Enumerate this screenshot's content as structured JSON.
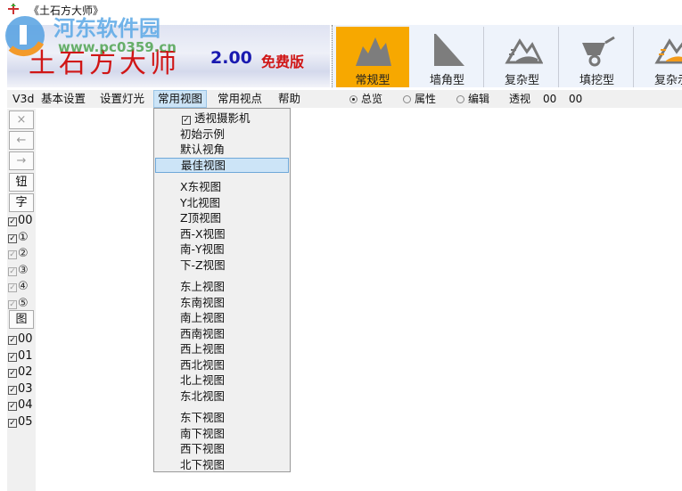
{
  "window": {
    "title": "《土石方大师》"
  },
  "banner": {
    "name": "土石方大师",
    "version": "2.00",
    "edition": "免费版"
  },
  "watermark": {
    "text": "河东软件园",
    "url": "www.pc0359.cn"
  },
  "toolbar": {
    "buttons": [
      {
        "label": "常规型",
        "icon": "mountain-icon",
        "active": true
      },
      {
        "label": "墙角型",
        "icon": "slope-icon",
        "active": false
      },
      {
        "label": "复杂型",
        "icon": "complex-terrain-icon",
        "active": false
      },
      {
        "label": "填挖型",
        "icon": "wheelbarrow-icon",
        "active": false
      },
      {
        "label": "复杂示",
        "icon": "complex-example-icon",
        "active": false
      }
    ]
  },
  "menubar": {
    "items": [
      "V3d",
      "基本设置",
      "设置灯光",
      "常用视图",
      "常用视点",
      "帮助"
    ],
    "open": "常用视图"
  },
  "viewmode": {
    "options": [
      "总览",
      "属性",
      "编辑"
    ],
    "selected": "总览",
    "perspective_label": "透视",
    "value1": "00",
    "value2": "00"
  },
  "leftpanel": {
    "buttons": [
      "×",
      "←",
      "→",
      "钮",
      "字"
    ],
    "checks1": [
      {
        "label": "00",
        "checked": true,
        "enabled": true
      },
      {
        "label": "①",
        "checked": true,
        "enabled": true
      },
      {
        "label": "②",
        "checked": true,
        "enabled": false
      },
      {
        "label": "③",
        "checked": true,
        "enabled": false
      },
      {
        "label": "④",
        "checked": true,
        "enabled": false
      },
      {
        "label": "⑤",
        "checked": true,
        "enabled": false
      }
    ],
    "image_button": "图",
    "checks2": [
      {
        "label": "00",
        "checked": true
      },
      {
        "label": "01",
        "checked": true
      },
      {
        "label": "02",
        "checked": true
      },
      {
        "label": "03",
        "checked": true
      },
      {
        "label": "04",
        "checked": true
      },
      {
        "label": "05",
        "checked": true
      }
    ]
  },
  "dropdown": {
    "groups": [
      [
        {
          "label": "透视摄影机",
          "checked": true
        },
        {
          "label": "初始示例"
        },
        {
          "label": "默认视角"
        },
        {
          "label": "最佳视图",
          "highlighted": true
        }
      ],
      [
        {
          "label": "X东视图"
        },
        {
          "label": "Y北视图"
        },
        {
          "label": "Z顶视图"
        },
        {
          "label": "西-X视图"
        },
        {
          "label": "南-Y视图"
        },
        {
          "label": "下-Z视图"
        }
      ],
      [
        {
          "label": "东上视图"
        },
        {
          "label": "东南视图"
        },
        {
          "label": "南上视图"
        },
        {
          "label": "西南视图"
        },
        {
          "label": "西上视图"
        },
        {
          "label": "西北视图"
        },
        {
          "label": "北上视图"
        },
        {
          "label": "东北视图"
        }
      ],
      [
        {
          "label": "东下视图"
        },
        {
          "label": "南下视图"
        },
        {
          "label": "西下视图"
        },
        {
          "label": "北下视图"
        }
      ]
    ]
  },
  "colors": {
    "active": "#f7a800",
    "highlight": "#cce4f7",
    "brand_red": "#d01616",
    "version_blue": "#1a1ab0"
  }
}
